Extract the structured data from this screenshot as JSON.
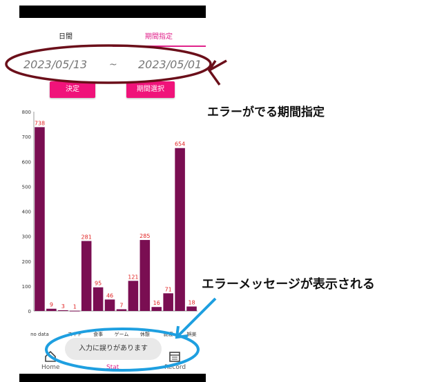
{
  "tabs": {
    "daily": "日間",
    "period": "期間指定"
  },
  "date_range": {
    "start": "2023/05/13",
    "separator": "~",
    "end": "2023/05/01"
  },
  "buttons": {
    "decide": "決定",
    "range_select": "期間選択"
  },
  "annotations": {
    "top": "エラーがでる期間指定",
    "bottom": "エラーメッセージが表示される"
  },
  "toast": "入力に誤りがあります",
  "nav": {
    "home": "Home",
    "stat": "Stat",
    "record": "Record"
  },
  "colors": {
    "accent": "#e0218a",
    "button": "#f0137a",
    "bar": "#7a0e52",
    "value_label": "#e02020",
    "annotation_red": "#6b0f1a",
    "annotation_blue": "#1e9fe0"
  },
  "icons": {
    "home": "home-icon",
    "stat": "stat-icon",
    "record": "calendar-icon"
  },
  "chart_data": {
    "type": "bar",
    "categories": [
      "no data",
      "",
      "スキド",
      "",
      "食事",
      "",
      "ゲーム",
      "",
      "休憩",
      "",
      "就寝",
      "娯楽"
    ],
    "tick_labels_shown": [
      "no data",
      "スキド",
      "食事",
      "ゲーム",
      "休憩",
      "就寝",
      "娯楽"
    ],
    "values": [
      738,
      9,
      3,
      1,
      281,
      95,
      46,
      7,
      121,
      285,
      16,
      71,
      654,
      18
    ],
    "ylim": [
      0,
      800
    ],
    "yticks": [
      0,
      100,
      200,
      300,
      400,
      500,
      600,
      700,
      800
    ],
    "grid": false
  }
}
